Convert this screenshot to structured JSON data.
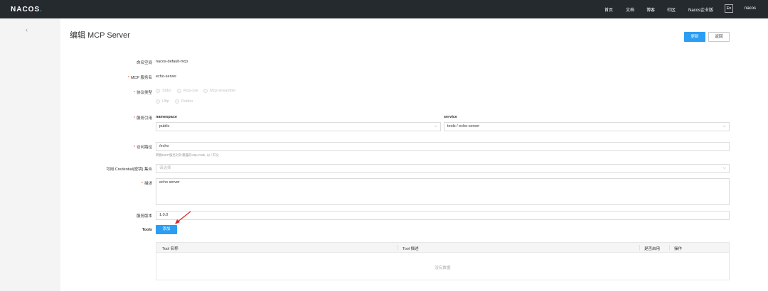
{
  "topbar": {
    "logo_main": "NACOS",
    "logo_dot": ".",
    "nav": [
      "首页",
      "文档",
      "博客",
      "社区",
      "Nacos企业版"
    ],
    "lang": "En",
    "user": "nacos"
  },
  "page": {
    "back_icon": "‹",
    "title": "编辑 MCP Server",
    "update_button": "更新",
    "back_button": "返回"
  },
  "form": {
    "namespace_label": "命名空间",
    "namespace_value": "nacos-default-mcp",
    "service_name_label": "MCP 服务名",
    "service_name_value": "echo-server",
    "protocol_label": "协议类型",
    "protocols": [
      "Stdio",
      "Mcp-sse",
      "Mcp-streamble",
      "Http",
      "Dubbo"
    ],
    "service_ref_label": "服务引用",
    "namespace_sub": "namespace",
    "namespace_select": "public",
    "service_sub": "service",
    "service_select": "tools / echo-server",
    "path_label": "访问路径",
    "path_value": "/echo",
    "path_hint": "转换MCP服务对外暴露的Http Path, 以 / 开头",
    "credential_label": "可用 Credential(密钥) 集合",
    "credential_placeholder": "请选择",
    "desc_label": "描述",
    "desc_value": "echo server",
    "version_label": "服务版本",
    "version_value": "1.0.0",
    "tools_label": "Tools",
    "add_button": "添加"
  },
  "table": {
    "columns": [
      "Tool 名称",
      "Tool 描述",
      "是否启用",
      "操作"
    ],
    "empty_text": "没有数据"
  },
  "colors": {
    "primary": "#2b9df3",
    "topbar": "#252a2f",
    "arrow": "#d9252c"
  }
}
